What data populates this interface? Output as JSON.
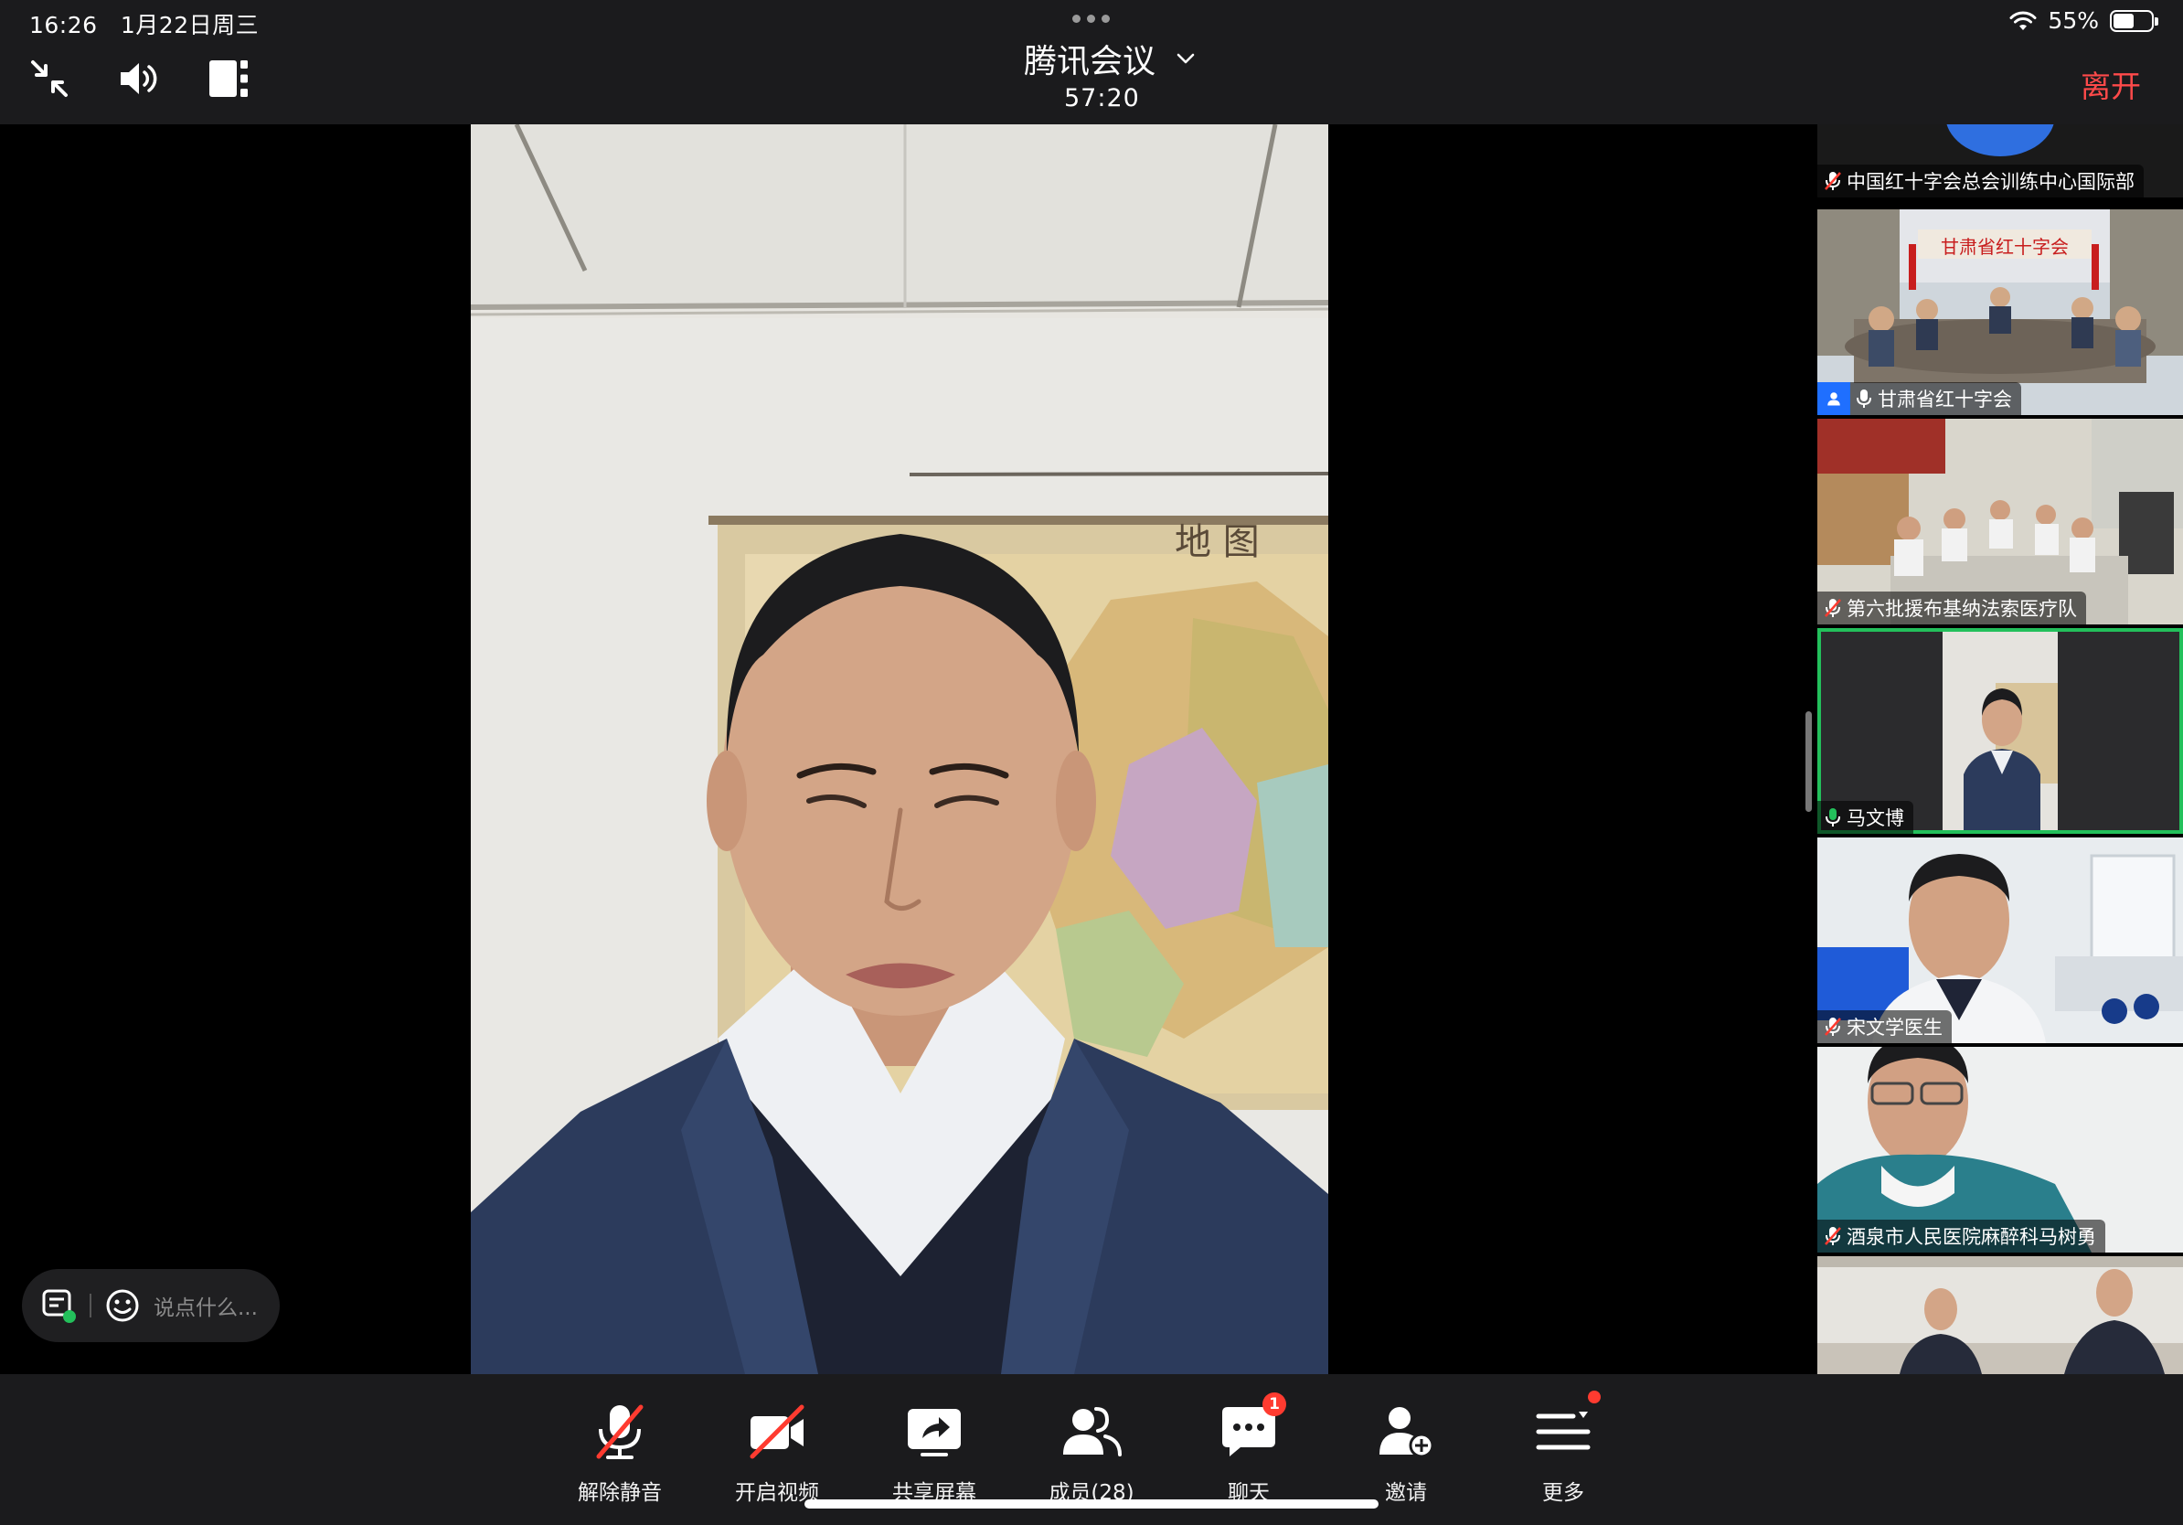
{
  "status_bar": {
    "time": "16:26",
    "date": "1月22日周三",
    "battery_percent": "55%",
    "battery_level": 0.55,
    "wifi_icon": "wifi-icon"
  },
  "header": {
    "app_title": "腾讯会议",
    "timer": "57:20",
    "leave_label": "离开",
    "icons": [
      "collapse-icon",
      "speaker-icon",
      "layout-icon",
      "chevron-down-icon"
    ]
  },
  "chat_input": {
    "placeholder": "说点什么..."
  },
  "participants": [
    {
      "name": "中国红十字会总会训练中心国际部",
      "mic": "muted"
    },
    {
      "name": "甘肃省红十字会",
      "mic": "on",
      "host": true
    },
    {
      "name": "第六批援布基纳法索医疗队",
      "mic": "muted"
    },
    {
      "name": "马文博",
      "mic": "active",
      "speaking": true
    },
    {
      "name": "宋文学医生",
      "mic": "muted"
    },
    {
      "name": "酒泉市人民医院麻醉科马树勇",
      "mic": "muted"
    },
    {
      "name": "",
      "mic": "none"
    }
  ],
  "toolbar": {
    "unmute_label": "解除静音",
    "video_label": "开启视频",
    "share_label": "共享屏幕",
    "members_label": "成员(28)",
    "chat_label": "聊天",
    "chat_badge": "1",
    "invite_label": "邀请",
    "more_label": "更多"
  },
  "colors": {
    "accent_green": "#23c05b",
    "leave_red": "#ff4a4a",
    "muted_red": "#ff3b30",
    "host_blue": "#1f6fff",
    "bar_bg": "#1b1b1d"
  }
}
